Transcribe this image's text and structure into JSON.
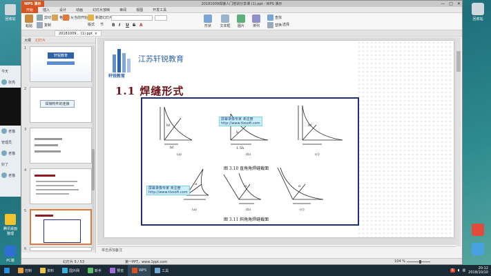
{
  "desktop": {
    "left_icons": [
      {
        "label": "回收站",
        "color": "#cfd8dc"
      },
      {
        "label": "腾讯桌面整理",
        "color": "#f2c230"
      },
      {
        "label": "PC端",
        "color": "#2d6fd2"
      }
    ],
    "right_icons": [
      {
        "label": "回收站",
        "color": "#cfd8dc"
      },
      {
        "label": "",
        "color": "#e04b3c"
      },
      {
        "label": "",
        "color": "#48a1e0"
      }
    ]
  },
  "chat": {
    "rows": [
      "今天",
      "张亮",
      "老师",
      "老猫",
      "管理员",
      "好了",
      "老猫",
      "好了",
      "老猫"
    ]
  },
  "window": {
    "app_button": "WPS 演示",
    "title": "20181009焊接人门培训分享课 (1).ppt - WPS 演示",
    "controls": [
      "—",
      "□",
      "✕"
    ]
  },
  "menu": {
    "items": [
      "开始",
      "插入",
      "设计",
      "动画",
      "幻灯片放映",
      "审阅",
      "视图",
      "开发工具"
    ],
    "active_index": 0
  },
  "ribbon": {
    "paste": "粘贴",
    "cut": "剪切",
    "copy": "复制",
    "format_painter": "格式刷",
    "from_current": "从当前开始",
    "new_slide": "新建幻灯片",
    "layout": "版式",
    "section": "节",
    "shape": "形状",
    "textbox": "文本框",
    "picture": "图片",
    "arrange": "排列",
    "find": "查找",
    "replace": "替换",
    "select": "选择",
    "format_labels": [
      "B",
      "I",
      "U",
      "S",
      "A"
    ]
  },
  "doc_tab": {
    "label": "20181009... (1).ppt",
    "close": "×"
  },
  "pane": {
    "tabs": [
      "大纲",
      "幻灯片"
    ],
    "active_tab": 1,
    "thumb_numbers": [
      "1",
      "2",
      "3",
      "4",
      "5",
      "6"
    ],
    "thumb_titles": [
      "轩锐教育",
      "焊接构件的连接",
      "",
      "",
      "",
      ""
    ],
    "selected_index": 4
  },
  "slide": {
    "company": "江苏轩锐教育",
    "logo_text": "轩锐教育",
    "title": "1.1   焊缝形式",
    "figure": {
      "caption_top": "图 3.10    直角角焊缝截面",
      "caption_bottom": "图 3.11    斜角角焊缝截面",
      "sub_labels_top": [
        "(a)",
        "(b)",
        "(c)"
      ],
      "sub_labels_bottom": [
        "(a)",
        "(b)",
        "(c)"
      ],
      "watermark_line1": "屏幕录像专家    未注册",
      "watermark_line2": "http://www.tlxsoft.com",
      "dims_top": [
        "1.5h",
        "h",
        "hf",
        "hf"
      ],
      "angle_label": "α"
    }
  },
  "notes": {
    "placeholder": "单击添加备注"
  },
  "status": {
    "slide_count": "幻灯片 5 / 53",
    "template": "第一PPT，www.1ppt.com",
    "zoom": "104 %"
  },
  "taskbar": {
    "items": [
      {
        "label": "",
        "color": "#2c8fe0"
      },
      {
        "label": "控制",
        "color": "#e9a13b"
      },
      {
        "label": "资料",
        "color": "#ecc448"
      },
      {
        "label": "国外网",
        "color": "#3bb0d8"
      },
      {
        "label": "新手",
        "color": "#5cc06a"
      },
      {
        "label": "预览",
        "color": "#a46bd8"
      },
      {
        "label": "WPS",
        "color": "#d9531e"
      },
      {
        "label": "工具",
        "color": "#6da7d8"
      }
    ],
    "active_index": 6,
    "time": "20:12",
    "date": "2018/10/10"
  }
}
